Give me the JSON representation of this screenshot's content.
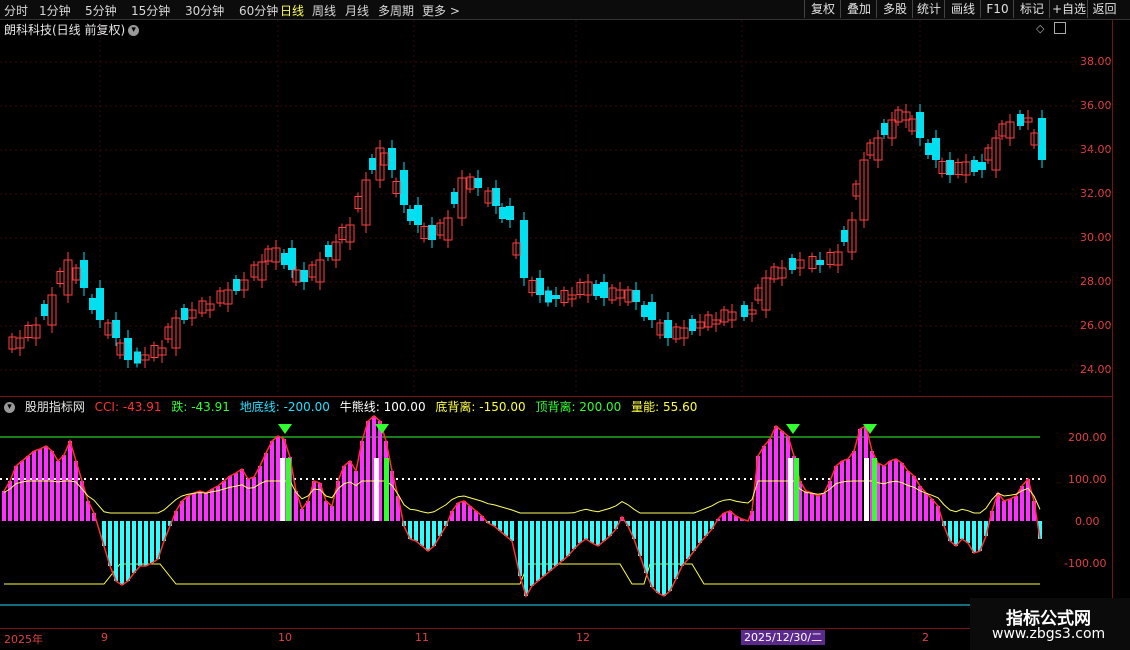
{
  "toolbar": {
    "timeframes": [
      "分时",
      "1分钟",
      "5分钟",
      "15分钟",
      "30分钟",
      "60分钟",
      "日线",
      "周线",
      "月线",
      "多周期",
      "更多 >"
    ],
    "active": "日线",
    "right_buttons": [
      "复权",
      "叠加",
      "多股",
      "统计",
      "画线",
      "F10",
      "标记",
      "+自选",
      "返回"
    ]
  },
  "main": {
    "title": "朗科科技(日线 前复权)",
    "y_ticks": [
      "38.00",
      "36.00",
      "34.00",
      "32.00",
      "30.00",
      "28.00",
      "26.00",
      "24.00"
    ]
  },
  "indicator": {
    "name": "股朋指标网",
    "items": [
      {
        "label": "CCI: -43.91",
        "color": "#ff3030"
      },
      {
        "label": "跌: -43.91",
        "color": "#30ff30"
      },
      {
        "label": "地底线: -200.00",
        "color": "#20e0ff"
      },
      {
        "label": "牛熊线: 100.00",
        "color": "#ffffff"
      },
      {
        "label": "底背离: -150.00",
        "color": "#ffff40"
      },
      {
        "label": "顶背离: 200.00",
        "color": "#30ff30"
      },
      {
        "label": "量能: 55.60",
        "color": "#ffff40"
      }
    ],
    "y_ticks": [
      "200.00",
      "100.00",
      "0.00",
      "-100.00"
    ]
  },
  "xaxis": {
    "labels": [
      "2025年",
      "9",
      "10",
      "11",
      "12",
      "2"
    ],
    "date_box": "2025/12/30/二"
  },
  "watermark": {
    "line1": "指标公式网",
    "line2": "www.zbgs3.com"
  },
  "colors": {
    "up": "#ff4040",
    "down": "#00e0f0",
    "grid": "#7a1010",
    "magenta": "#ff30ff",
    "cyan": "#30ffff"
  }
}
